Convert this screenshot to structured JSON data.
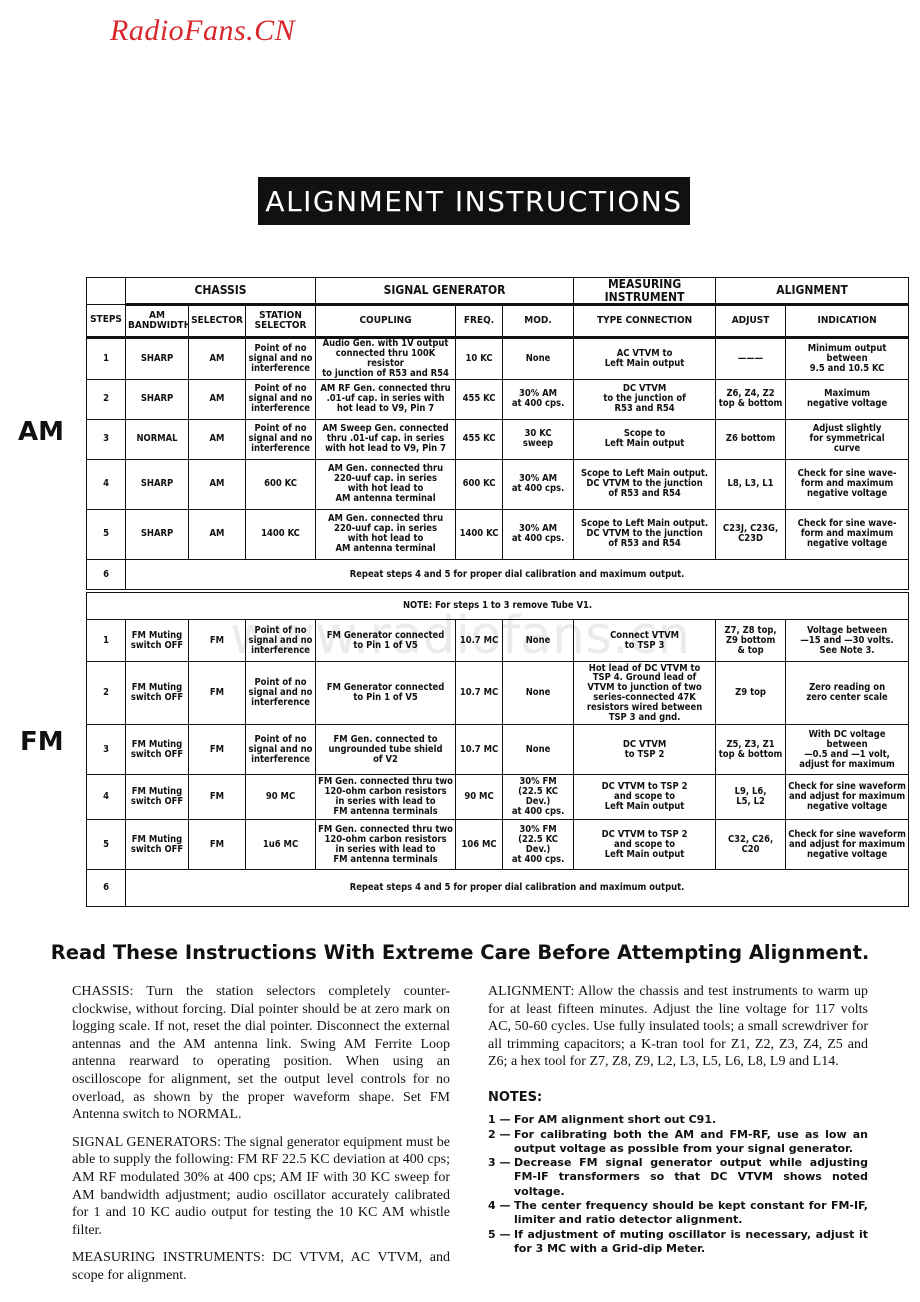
{
  "logo": "RadioFans.CN",
  "title": "ALIGNMENT INSTRUCTIONS",
  "watermark": "www.radiofans.cn",
  "section_labels": {
    "am": "AM",
    "fm": "FM"
  },
  "table": {
    "group_headers": {
      "chassis": "CHASSIS",
      "signal_generator": "SIGNAL GENERATOR",
      "measuring_instrument": "MEASURING INSTRUMENT",
      "alignment": "ALIGNMENT"
    },
    "columns": [
      "STEPS",
      "AM\nBANDWIDTH",
      "SELECTOR",
      "STATION\nSELECTOR",
      "COUPLING",
      "FREQ.",
      "MOD.",
      "TYPE CONNECTION",
      "ADJUST",
      "INDICATION"
    ],
    "am_rows": [
      [
        "1",
        "SHARP",
        "AM",
        "Point of no\nsignal and no\ninterference",
        "Audio Gen. with 1V output\nconnected thru 100K resistor\nto junction of R53 and R54",
        "10 KC",
        "None",
        "AC VTVM to\nLeft Main output",
        "———",
        "Minimum output\nbetween\n9.5 and 10.5 KC"
      ],
      [
        "2",
        "SHARP",
        "AM",
        "Point of no\nsignal and no\ninterference",
        "AM RF Gen. connected thru\n.01-uf cap. in series with\nhot lead to V9, Pin 7",
        "455 KC",
        "30% AM\nat 400 cps.",
        "DC VTVM\nto the junction of\nR53 and R54",
        "Z6, Z4, Z2\ntop & bottom",
        "Maximum\nnegative voltage"
      ],
      [
        "3",
        "NORMAL",
        "AM",
        "Point of no\nsignal and no\ninterference",
        "AM Sweep Gen. connected\nthru .01-uf cap. in series\nwith hot lead to V9, Pin 7",
        "455 KC",
        "30 KC\nsweep",
        "Scope to\nLeft Main output",
        "Z6 bottom",
        "Adjust slightly\nfor symmetrical\ncurve"
      ],
      [
        "4",
        "SHARP",
        "AM",
        "600 KC",
        "AM Gen. connected thru\n220-uuf cap. in series\nwith hot lead to\nAM antenna terminal",
        "600 KC",
        "30% AM\nat 400 cps.",
        "Scope to Left Main output.\nDC VTVM to the junction\nof R53 and R54",
        "L8, L3, L1",
        "Check for sine wave-\nform and maximum\nnegative voltage"
      ],
      [
        "5",
        "SHARP",
        "AM",
        "1400 KC",
        "AM Gen. connected thru\n220-uuf cap. in series\nwith hot lead to\nAM antenna terminal",
        "1400 KC",
        "30% AM\nat 400 cps.",
        "Scope to Left Main output.\nDC VTVM to the junction\nof R53 and R54",
        "C23J, C23G,\nC23D",
        "Check for sine wave-\nform and maximum\nnegative voltage"
      ]
    ],
    "am_step6": {
      "step": "6",
      "text": "Repeat steps 4 and 5 for proper dial calibration and maximum output."
    },
    "note": "NOTE: For steps 1 to 3 remove Tube V1.",
    "fm_rows": [
      [
        "1",
        "FM Muting\nswitch OFF",
        "FM",
        "Point of no\nsignal and no\ninterference",
        "FM Generator connected\nto Pin 1 of V5",
        "10.7 MC",
        "None",
        "Connect VTVM\nto TSP 3",
        "Z7, Z8 top,\nZ9 bottom\n& top",
        "Voltage between\n—15 and —30 volts.\nSee Note 3."
      ],
      [
        "2",
        "FM Muting\nswitch OFF",
        "FM",
        "Point of no\nsignal and no\ninterference",
        "FM Generator connected\nto Pin 1 of V5",
        "10.7 MC",
        "None",
        "Hot lead of DC VTVM to\nTSP 4. Ground lead of\nVTVM to junction of two\nseries-connected 47K\nresistors wired between\nTSP 3 and gnd.",
        "Z9 top",
        "Zero reading on\nzero center scale"
      ],
      [
        "3",
        "FM Muting\nswitch OFF",
        "FM",
        "Point of no\nsignal and no\ninterference",
        "FM Gen. connected to\nungrounded tube shield\nof V2",
        "10.7 MC",
        "None",
        "DC VTVM\nto TSP 2",
        "Z5, Z3, Z1\ntop & bottom",
        "With DC voltage between\n—0.5 and —1 volt,\nadjust for maximum"
      ],
      [
        "4",
        "FM Muting\nswitch OFF",
        "FM",
        "90 MC",
        "FM Gen. connected thru two\n120-ohm carbon resistors\nin series with lead to\nFM antenna terminals",
        "90 MC",
        "30% FM\n(22.5 KC Dev.)\nat 400 cps.",
        "DC VTVM to TSP 2\nand scope to\nLeft Main output",
        "L9, L6,\nL5, L2",
        "Check for sine waveform\nand adjust for maximum\nnegative voltage"
      ],
      [
        "5",
        "FM Muting\nswitch OFF",
        "FM",
        "1u6 MC",
        "FM Gen. connected thru two\n120-ohm carbon resistors\nin series with lead to\nFM antenna terminals",
        "106 MC",
        "30% FM\n(22.5 KC Dev.)\nat 400 cps.",
        "DC VTVM to TSP 2\nand scope to\nLeft Main output",
        "C32, C26,\nC20",
        "Check for sine waveform\nand adjust for maximum\nnegative voltage"
      ]
    ],
    "fm_step6": {
      "step": "6",
      "text": "Repeat steps 4 and 5 for proper dial calibration and maximum output."
    }
  },
  "heading": "Read These Instructions With Extreme Care Before Attempting Alignment.",
  "left_paragraphs": [
    "CHASSIS: Turn the station selectors completely counter-clockwise, without forcing. Dial pointer should be at zero mark on logging scale. If not, reset the dial pointer. Disconnect the external antennas and the AM antenna link. Swing AM Ferrite Loop antenna rearward to operating position. When using an oscilloscope for alignment, set the output level controls for no overload, as shown by the proper waveform shape. Set FM Antenna switch to NORMAL.",
    "SIGNAL GENERATORS: The signal generator equipment must be able to supply the following: FM RF 22.5 KC deviation at 400 cps; AM RF modulated 30% at 400 cps; AM IF with 30 KC sweep for AM bandwidth adjustment; audio oscillator accurately calibrated for 1 and 10 KC audio output for testing the 10 KC AM whistle filter.",
    "MEASURING INSTRUMENTS: DC VTVM, AC VTVM, and scope for alignment."
  ],
  "right_paragraph": "ALIGNMENT: Allow the chassis and test instruments to warm up for at least fifteen minutes. Adjust the line voltage for 117 volts AC, 50-60 cycles. Use fully insulated tools; a small screwdriver for all trimming capacitors; a K-tran tool for Z1, Z2, Z3, Z4, Z5 and Z6; a hex tool for Z7, Z8, Z9, L2, L3, L5, L6, L8, L9 and L14.",
  "notes": {
    "title": "NOTES:",
    "items": [
      {
        "num": "1 —",
        "text": "For AM alignment short out C91."
      },
      {
        "num": "2 —",
        "text": "For calibrating both the AM and FM-RF, use as low an output voltage as possible from your signal generator."
      },
      {
        "num": "3 —",
        "text": "Decrease FM signal generator output while adjusting FM-IF transformers so that DC VTVM shows noted voltage."
      },
      {
        "num": "4 —",
        "text": "The center frequency should be kept constant for FM-IF, limiter and ratio detector alignment."
      },
      {
        "num": "5 —",
        "text": "If adjustment of muting oscillator is necessary, adjust it for 3 MC with a Grid-dip Meter."
      }
    ]
  }
}
